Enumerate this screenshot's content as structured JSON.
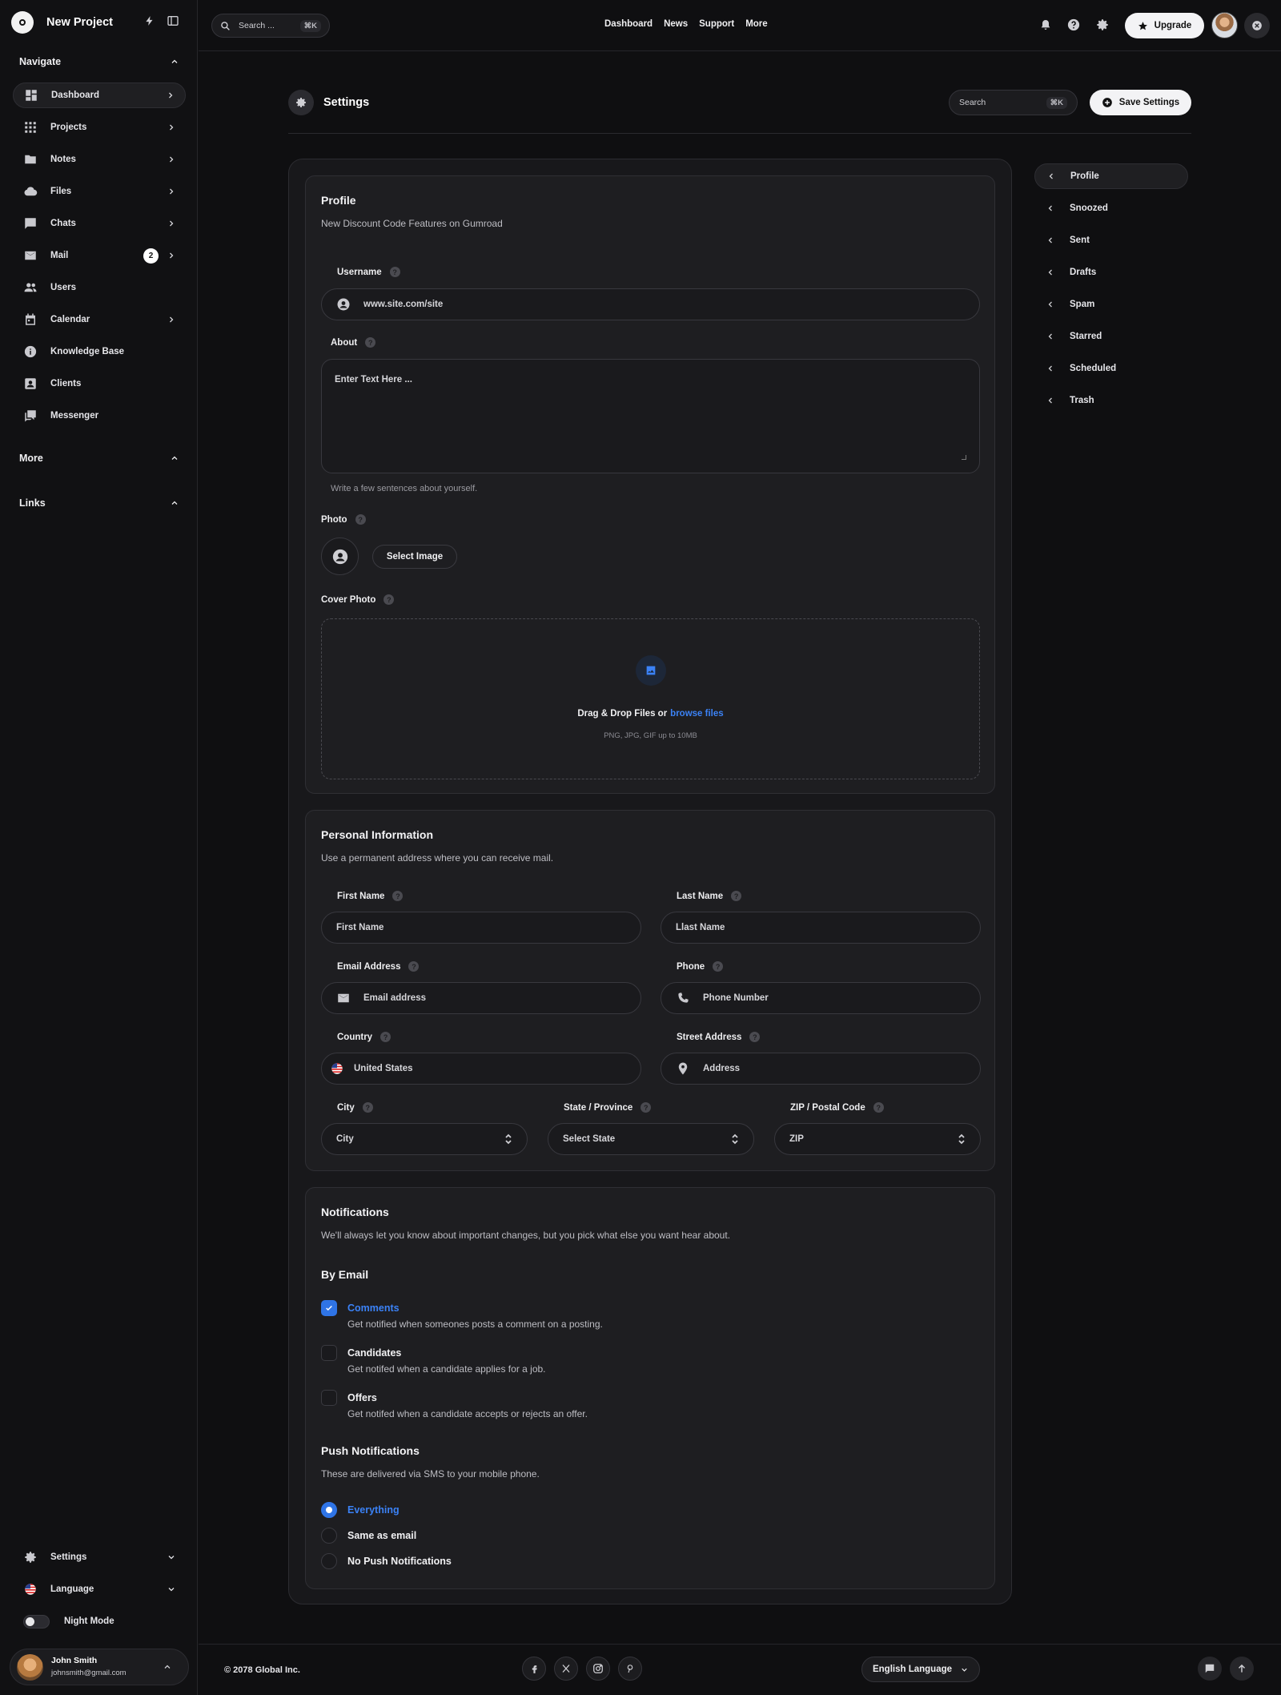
{
  "app": {
    "title": "New Project"
  },
  "sidebar": {
    "navigate_label": "Navigate",
    "more_label": "More",
    "links_label": "Links",
    "items": [
      {
        "label": "Dashboard",
        "icon": "dashboard-icon"
      },
      {
        "label": "Projects",
        "icon": "grid-icon"
      },
      {
        "label": "Notes",
        "icon": "folder-icon"
      },
      {
        "label": "Files",
        "icon": "cloud-icon"
      },
      {
        "label": "Chats",
        "icon": "chat-icon"
      },
      {
        "label": "Mail",
        "icon": "mail-icon",
        "badge": "2"
      },
      {
        "label": "Users",
        "icon": "users-icon"
      },
      {
        "label": "Calendar",
        "icon": "calendar-icon"
      },
      {
        "label": "Knowledge Base",
        "icon": "info-icon"
      },
      {
        "label": "Clients",
        "icon": "contact-icon"
      },
      {
        "label": "Messenger",
        "icon": "messenger-icon"
      }
    ],
    "settings_label": "Settings",
    "language_label": "Language",
    "night_mode_label": "Night Mode",
    "user": {
      "name": "John Smith",
      "email": "johnsmith@gmail.com"
    }
  },
  "topbar": {
    "search_placeholder": "Search ...",
    "search_kbd": "⌘K",
    "nav": [
      "Dashboard",
      "News",
      "Support",
      "More"
    ],
    "upgrade_label": "Upgrade"
  },
  "page": {
    "title": "Settings",
    "search_placeholder": "Search",
    "search_kbd": "⌘K",
    "save_label": "Save Settings"
  },
  "profile": {
    "title": "Profile",
    "subtitle": "New Discount Code Features on Gumroad",
    "username_label": "Username",
    "username_value": "www.site.com/site",
    "about_label": "About",
    "about_placeholder": "Enter Text Here ...",
    "about_hint": "Write a few sentences about yourself.",
    "photo_label": "Photo",
    "select_image_label": "Select Image",
    "cover_label": "Cover Photo",
    "drop_text": "Drag & Drop Files or",
    "browse_text": "browse files",
    "drop_sub": "PNG, JPG, GIF up to 10MB"
  },
  "personal": {
    "title": "Personal Information",
    "subtitle": "Use a permanent address where you can receive mail.",
    "first_name_label": "First Name",
    "first_name_placeholder": "First Name",
    "last_name_label": "Last Name",
    "last_name_placeholder": "Llast Name",
    "email_label": "Email Address",
    "email_placeholder": "Email address",
    "phone_label": "Phone",
    "phone_placeholder": "Phone Number",
    "country_label": "Country",
    "country_value": "United States",
    "street_label": "Street Address",
    "street_placeholder": "Address",
    "city_label": "City",
    "city_value": "City",
    "state_label": "State / Province",
    "state_value": "Select State",
    "zip_label": "ZIP / Postal Code",
    "zip_value": "ZIP"
  },
  "notifications": {
    "title": "Notifications",
    "subtitle": "We'll always let you know about important changes, but you pick what else you want hear about.",
    "by_email_label": "By Email",
    "email_options": [
      {
        "title": "Comments",
        "desc": "Get notified when someones posts a comment on a posting.",
        "checked": true
      },
      {
        "title": "Candidates",
        "desc": "Get notifed when a candidate applies for a job.",
        "checked": false
      },
      {
        "title": "Offers",
        "desc": "Get notifed when a candidate accepts or rejects an offer.",
        "checked": false
      }
    ],
    "push_label": "Push Notifications",
    "push_sub": "These are delivered via SMS to your mobile phone.",
    "push_options": [
      {
        "label": "Everything",
        "selected": true
      },
      {
        "label": "Same as email",
        "selected": false
      },
      {
        "label": "No Push Notifications",
        "selected": false
      }
    ]
  },
  "right_nav": [
    "Profile",
    "Snoozed",
    "Sent",
    "Drafts",
    "Spam",
    "Starred",
    "Scheduled",
    "Trash"
  ],
  "footer": {
    "copyright": "© 2078 Global Inc.",
    "socials": [
      "facebook-icon",
      "x-icon",
      "instagram-icon",
      "pinterest-icon"
    ],
    "language_label": "English Language"
  },
  "colors": {
    "accent": "#2f74e6",
    "link": "#3b82f6",
    "background": "#0f0f11",
    "panel": "#1e1e21"
  }
}
